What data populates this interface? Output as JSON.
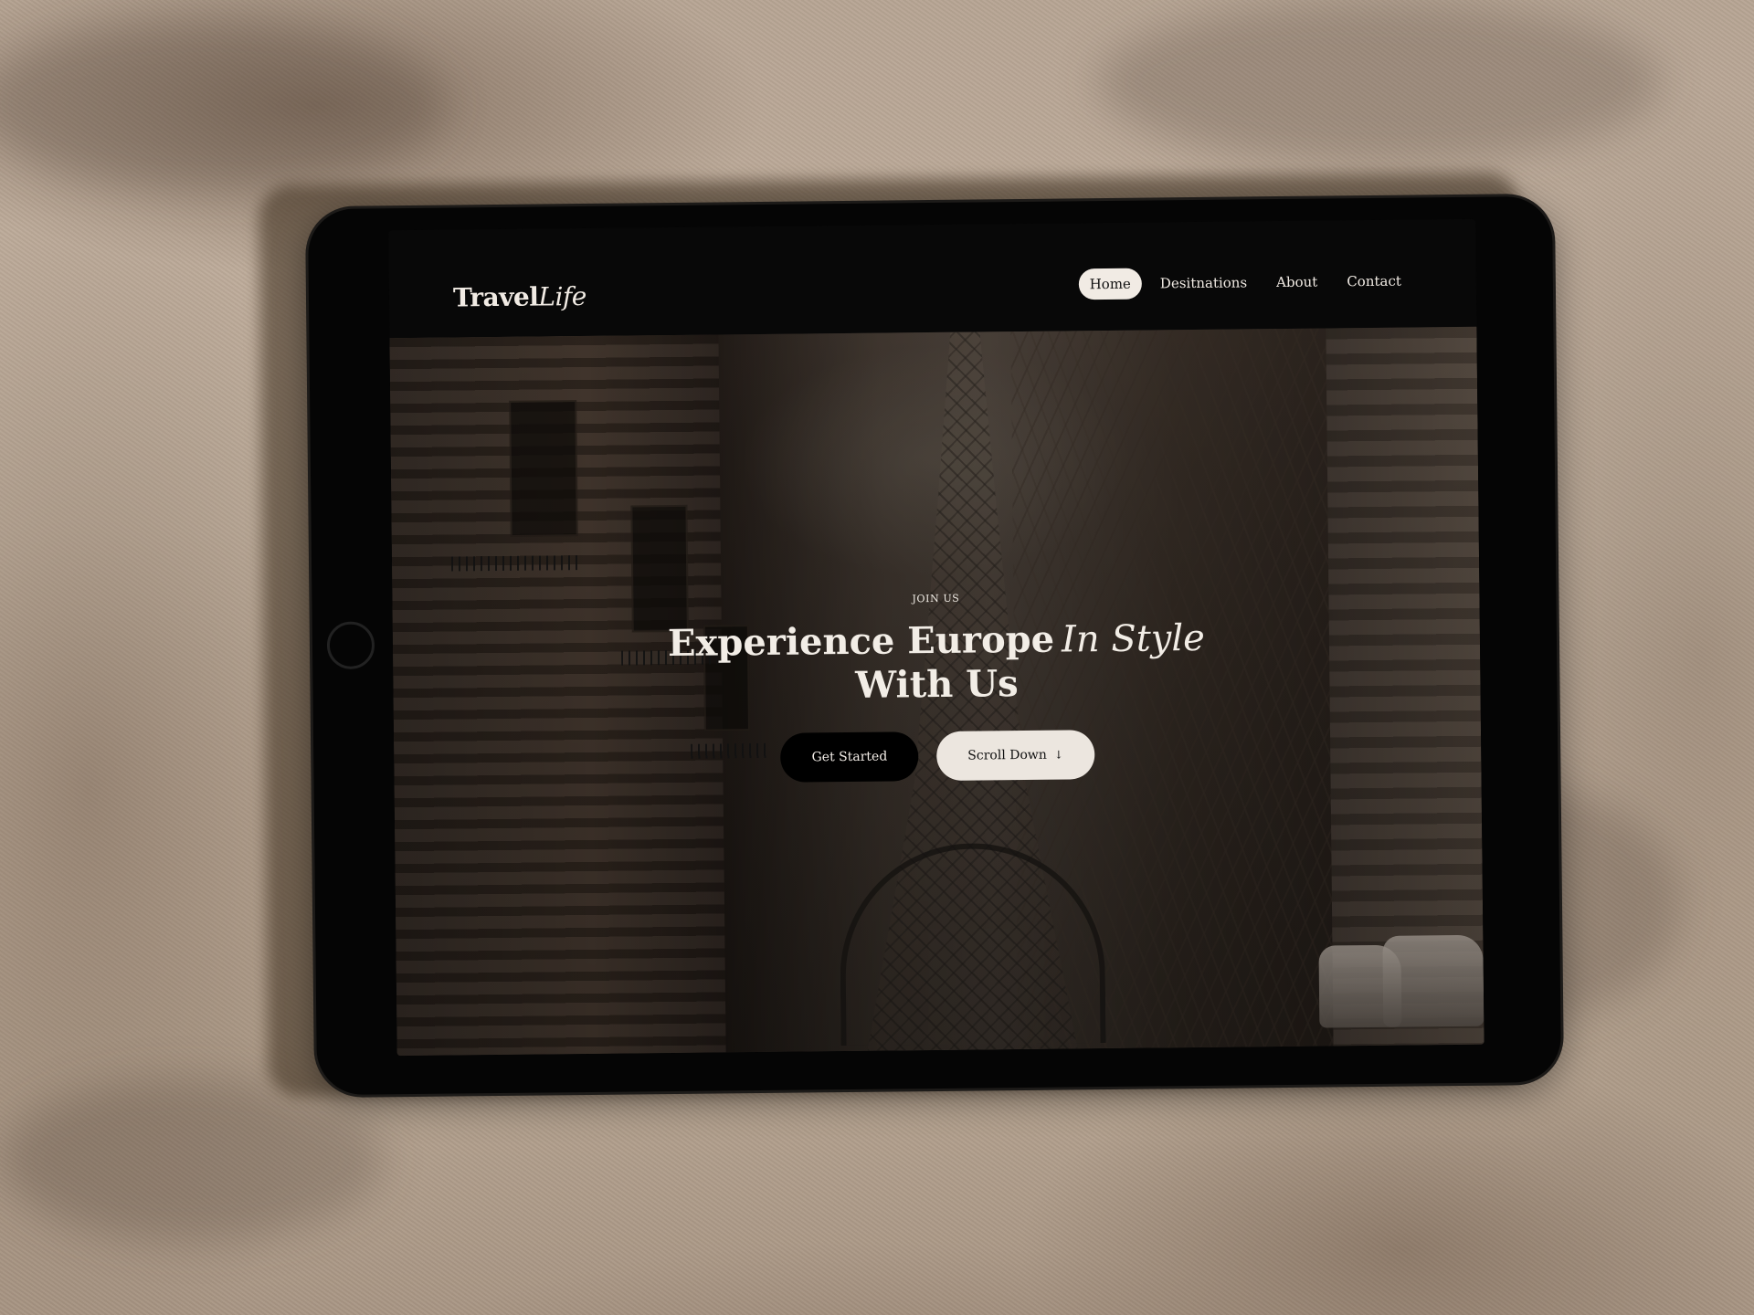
{
  "nav": {
    "brand_primary": "Travel",
    "brand_secondary": "Life",
    "items": [
      {
        "label": "Home"
      },
      {
        "label": "Desitnations"
      },
      {
        "label": "About"
      },
      {
        "label": "Contact"
      }
    ]
  },
  "hero": {
    "eyebrow": "JOIN US",
    "headline_line1": "Experience Europe",
    "headline_accent": "In Style",
    "headline_line2": "With Us",
    "primary_button": "Get Started",
    "secondary_button": "Scroll Down",
    "secondary_icon": "↓"
  },
  "icons": {
    "secondary_button": "arrow-down-icon"
  }
}
